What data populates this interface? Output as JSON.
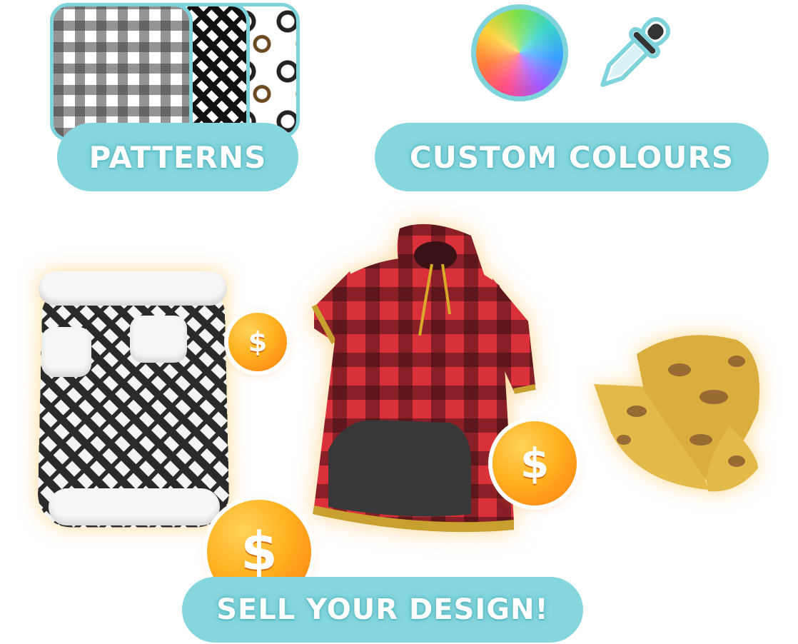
{
  "labels": {
    "patterns": "PATTERNS",
    "custom_colours": "CUSTOM COLOURS",
    "sell": "SELL YOUR DESIGN!"
  },
  "coins": [
    {
      "symbol": "$"
    },
    {
      "symbol": "$"
    },
    {
      "symbol": "$"
    }
  ],
  "icons": {
    "color_wheel": "color-wheel-icon",
    "eyedropper": "eyedropper-icon"
  },
  "colors": {
    "pill": "#86d6de",
    "pill_border": "#7fd3db",
    "coin": "#ffb21f",
    "plaid_red": "#d9303a"
  }
}
